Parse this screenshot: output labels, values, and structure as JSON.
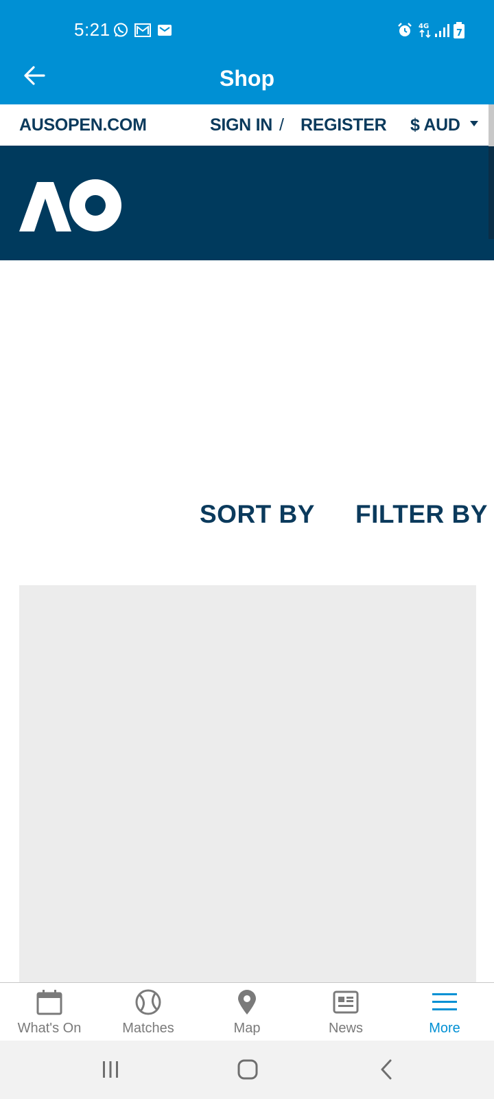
{
  "status_bar": {
    "time": "5:21",
    "network": "4G",
    "battery_level": "7",
    "left_icons": [
      "whatsapp-icon",
      "gmail-icon",
      "gmail-icon"
    ],
    "right_icons": [
      "alarm-icon",
      "network-4g-icon",
      "signal-icon",
      "battery-icon"
    ]
  },
  "app_bar": {
    "title": "Shop",
    "back_icon": "arrow-left-icon"
  },
  "site_nav": {
    "home_link": "AUSOPEN.COM",
    "sign_in": "SIGN IN",
    "separator": "/",
    "register": "REGISTER",
    "currency": "$ AUD"
  },
  "brand": {
    "logo_text": "AO"
  },
  "controls": {
    "sort_label": "SORT BY",
    "filter_label": "FILTER BY"
  },
  "tabs": [
    {
      "label": "What's On",
      "icon": "calendar-icon",
      "active": false
    },
    {
      "label": "Matches",
      "icon": "tennis-ball-icon",
      "active": false
    },
    {
      "label": "Map",
      "icon": "map-pin-icon",
      "active": false
    },
    {
      "label": "News",
      "icon": "newspaper-icon",
      "active": false
    },
    {
      "label": "More",
      "icon": "menu-icon",
      "active": true
    }
  ],
  "colors": {
    "header_blue": "#0090d4",
    "navy": "#0b3a5c",
    "banner_navy": "#003a5d",
    "tab_inactive": "#7a7a7a",
    "tab_active": "#0090d4",
    "placeholder_gray": "#ececec"
  }
}
